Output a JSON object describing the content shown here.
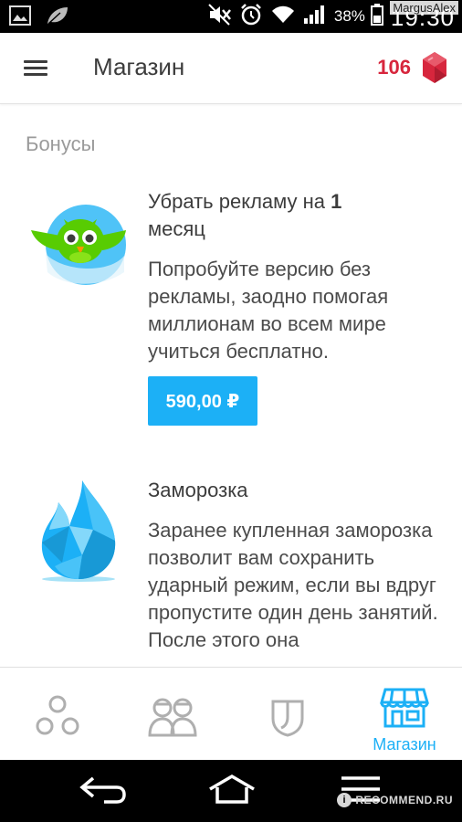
{
  "status_bar": {
    "battery_percent": "38%",
    "time": "19:30",
    "icons": [
      "image-icon",
      "leaf-icon",
      "mute-icon",
      "alarm-icon",
      "wifi-icon",
      "signal-icon",
      "battery-icon"
    ]
  },
  "watermarks": {
    "top_right": "MargusAlex",
    "bottom_right": "RECOMMEND.RU",
    "bottom_badge": "i"
  },
  "app_bar": {
    "title": "Магазин",
    "gem_count": "106",
    "gem_color": "#d7263d"
  },
  "section": {
    "title": "Бонусы"
  },
  "items": [
    {
      "title_prefix": "Убрать рекламу на ",
      "title_bold": "1",
      "title_suffix": "месяц",
      "description": "Попробуйте версию без рекламы, заодно помогая миллионам во всем мире учиться бесплатно.",
      "price": "590,00 ₽",
      "icon": "owl-icon"
    },
    {
      "title": "Заморозка",
      "description": "Заранее купленная заморозка позволит вам сохранить ударный режим, если вы вдруг пропустите один день занятий. После этого она",
      "icon": "freeze-flame-icon"
    }
  ],
  "bottom_nav": {
    "tabs": [
      {
        "name": "learn",
        "icon": "circles-icon",
        "label": ""
      },
      {
        "name": "clubs",
        "icon": "people-icon",
        "label": ""
      },
      {
        "name": "leagues",
        "icon": "shield-icon",
        "label": ""
      },
      {
        "name": "shop",
        "icon": "shop-icon",
        "label": "Магазин"
      }
    ],
    "active_color": "#1cb0f6",
    "inactive_color": "#afafaf"
  },
  "colors": {
    "accent": "#1cb0f6",
    "text": "#3c3c3c",
    "muted": "#9a9a9a",
    "gem": "#d7263d"
  }
}
